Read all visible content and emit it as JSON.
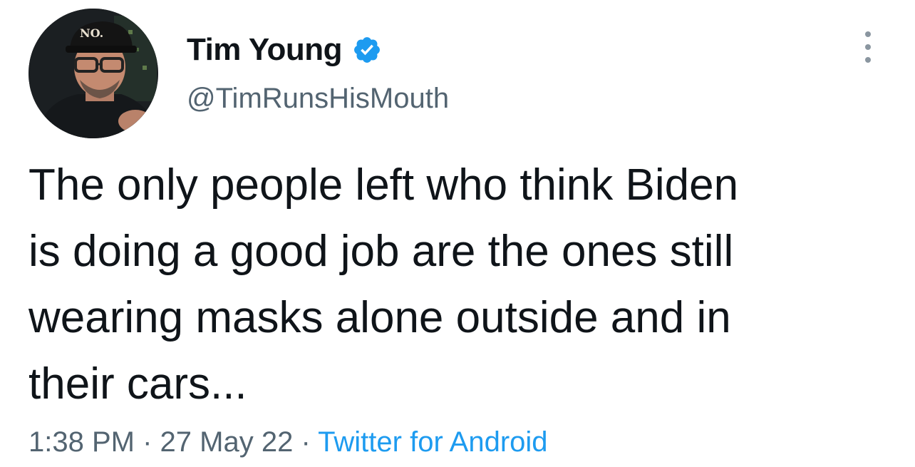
{
  "author": {
    "display_name": "Tim Young",
    "handle": "@TimRunsHisMouth",
    "verified": true,
    "avatar_hat_text": "NO."
  },
  "tweet": {
    "text": "The only people left who think Biden\nis doing a good job are the ones still\nwearing masks alone outside and in\ntheir cars...",
    "time": "1:38 PM",
    "date": "27 May 22",
    "separator": "·",
    "source": "Twitter for Android"
  },
  "icons": {
    "verified": "verified-badge-icon",
    "more": "more-options-icon"
  },
  "colors": {
    "verified_blue": "#1d9bf0",
    "text_primary": "#0f1419",
    "text_secondary": "#536471",
    "link": "#1d9bf0"
  }
}
